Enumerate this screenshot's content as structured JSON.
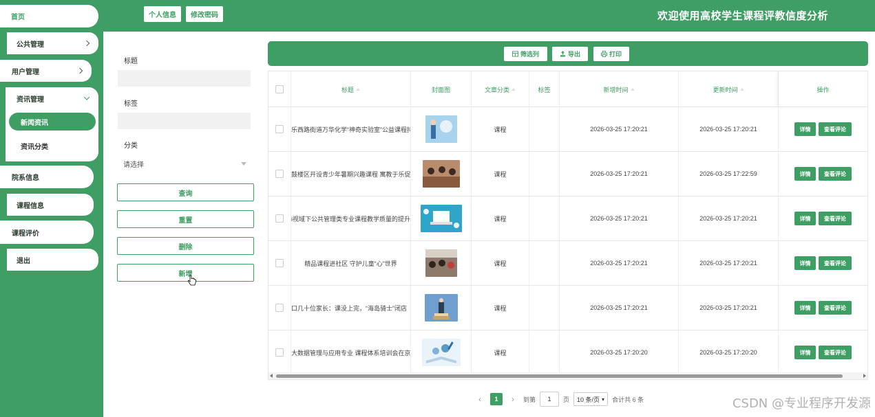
{
  "header": {
    "title": "欢迎使用高校学生课程评教信度分析",
    "buttons": [
      "个人信息",
      "修改密码"
    ]
  },
  "sidebar": {
    "items": [
      {
        "label": "首页"
      },
      {
        "label": "公共管理"
      },
      {
        "label": "用户管理"
      },
      {
        "label": "资讯管理"
      },
      {
        "label": "院系信息"
      },
      {
        "label": "课程信息"
      },
      {
        "label": "课程评价"
      },
      {
        "label": "退出"
      }
    ],
    "sub_items": [
      "新闻资讯",
      "资讯分类"
    ]
  },
  "search": {
    "title_label": "标题",
    "tag_label": "标签",
    "category_label": "分类",
    "category_placeholder": "请选择",
    "buttons": [
      "查询",
      "重置",
      "删除",
      "新增"
    ]
  },
  "toolbar": {
    "buttons": [
      "筛选列",
      "导出",
      "打印"
    ]
  },
  "table": {
    "columns": [
      "标题",
      "封面图",
      "文章分类",
      "标签",
      "新增时间",
      "更新时间",
      "操作"
    ],
    "rows": [
      {
        "title": "乐西路街道万华化学“神奇实验室”公益课程持",
        "category": "课程",
        "tag": "",
        "created": "2026-03-25 17:20:21",
        "updated": "2026-03-25 17:20:21"
      },
      {
        "title": "鼓楼区开设青少年暑期兴趣课程 寓教于乐促",
        "category": "课程",
        "tag": "",
        "created": "2026-03-25 17:20:21",
        "updated": "2026-03-25 17:22:59"
      },
      {
        "title": "i视域下公共管理类专业课程教学质量的提升",
        "category": "课程",
        "tag": "",
        "created": "2026-03-25 17:20:21",
        "updated": "2026-03-25 17:20:21"
      },
      {
        "title": "精品课程进社区 守护儿童“心”世界",
        "category": "课程",
        "tag": "",
        "created": "2026-03-25 17:20:21",
        "updated": "2026-03-25 17:20:21"
      },
      {
        "title": "口几十位家长：课没上完，“海岛骑士”闭店",
        "category": "课程",
        "tag": "",
        "created": "2026-03-25 17:20:21",
        "updated": "2026-03-25 17:20:21"
      },
      {
        "title": "大数据管理与应用专业 课程体系培训会在京",
        "category": "课程",
        "tag": "",
        "created": "2026-03-25 17:20:20",
        "updated": "2026-03-25 17:20:20"
      }
    ],
    "action_detail": "详情",
    "action_comments": "查看评论"
  },
  "pagination": {
    "current_page": "1",
    "goto_prefix": "到第",
    "goto_value": "1",
    "goto_suffix": "页",
    "page_size": "10 条/页",
    "total": "合计共 6 条"
  },
  "watermark": "CSDN @专业程序开发源",
  "colors": {
    "primary": "#3e9e63",
    "background": "#ffffff"
  }
}
